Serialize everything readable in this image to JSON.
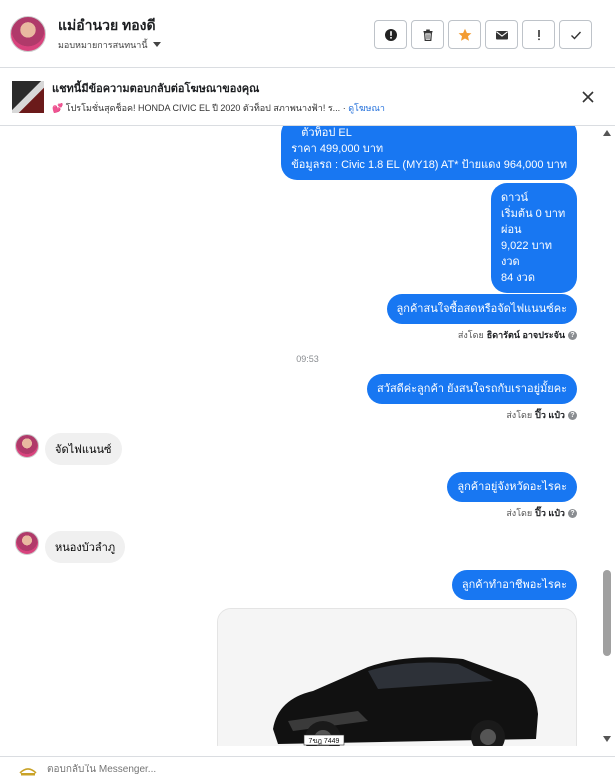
{
  "header": {
    "name": "แม่อำนวย ทองดี",
    "assignee_label": "มอบหมายการสนทนานี้",
    "actions": [
      "alert-circle-icon",
      "trash-icon",
      "star-icon",
      "envelope-icon",
      "exclamation-icon",
      "check-icon"
    ],
    "accent_star": "#f39c33"
  },
  "ad_banner": {
    "title": "แชทนี้มีข้อความตอบกลับต่อโฆษณาของคุณ",
    "emoji": "💕",
    "description": "โปรโมชั่นสุดช็อค! HONDA CIVIC EL ปี 2020 ตัวท็อป สภาพนางฟ้า! ร...",
    "separator": "·",
    "link": "ดูโฆษณา"
  },
  "messages": {
    "m1": {
      "line1": "ตัวท็อป EL",
      "line2": "ราคา 499,000 บาท",
      "line3": "ข้อมูลรถ : Civic 1.8 EL (MY18) AT* ป้ายแดง 964,000 บาท"
    },
    "m2": {
      "lines": [
        "ดาวน์",
        "เริ่มต้น 0 บาท",
        "ผ่อน",
        "9,022 บาท",
        "งวด",
        "84 งวด"
      ]
    },
    "m3": "ลูกค้าสนใจซื้อสดหรือจัดไฟแนนซ์คะ",
    "sent1": {
      "prefix": "ส่งโดย",
      "name": "ธิดารัตน์ อาจประจัน"
    },
    "time": "09:53",
    "m4": "สวัสดีค่ะลูกค้า ยังสนใจรถกับเราอยู่มั้ยคะ",
    "sent2": {
      "prefix": "ส่งโดย",
      "name": "ปิ๊ว แป๋ว"
    },
    "in1": "จัดไฟแนนซ์",
    "m5": "ลูกค้าอยู่จังหวัดอะไรคะ",
    "sent3": {
      "prefix": "ส่งโดย",
      "name": "ปิ๊ว แป๋ว"
    },
    "in2": "หนองบัวลำภู",
    "m6": "ลูกค้าทำอาชีพอะไรคะ",
    "plate": "7ขฎ 7449"
  },
  "reply": {
    "placeholder": "ตอบกลับใน Messenger..."
  },
  "colors": {
    "outgoing_bubble": "#1877f2",
    "incoming_bubble": "#f0f0f0"
  }
}
